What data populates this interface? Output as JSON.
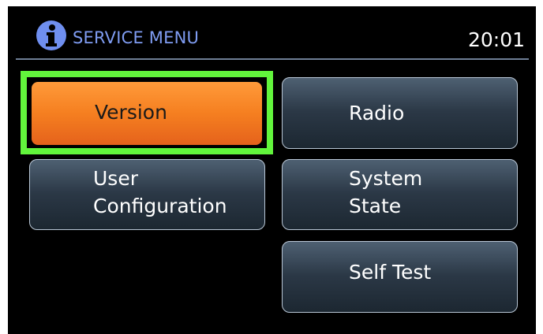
{
  "header": {
    "icon": "info-icon",
    "title": "SERVICE MENU",
    "clock": "20:01",
    "title_color": "#7f9cf2"
  },
  "menu": {
    "version_label": "Version",
    "radio_label": "Radio",
    "user_config_line1": "User",
    "user_config_line2": "Configuration",
    "system_state_line1": "System",
    "system_state_line2": "State",
    "self_test_label": "Self Test",
    "selected_item": "Version"
  },
  "colors": {
    "selected_button": "#f57f20",
    "highlight_frame": "#62f53c",
    "button_border": "#b9c7d6"
  }
}
